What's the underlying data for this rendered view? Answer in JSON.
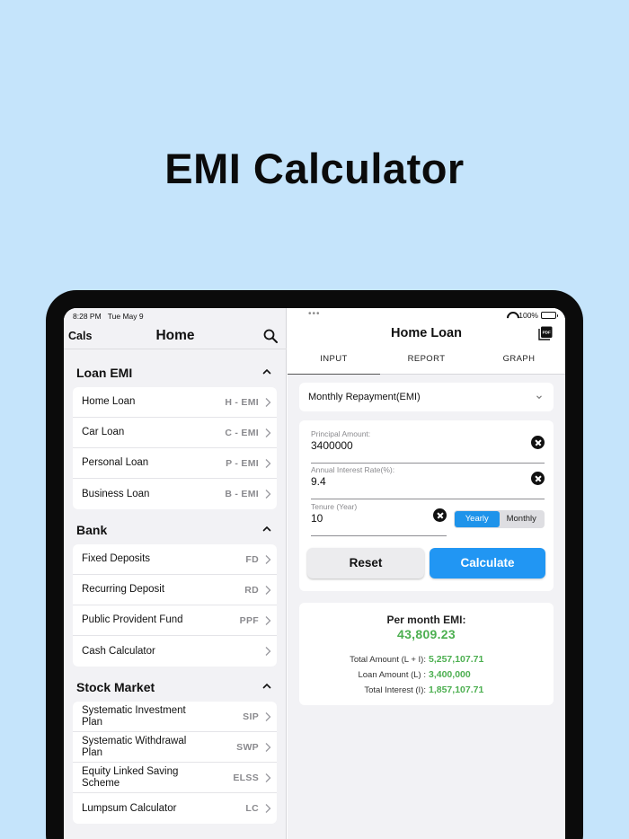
{
  "headline": "EMI Calculator",
  "status": {
    "time": "8:28 PM",
    "date": "Tue May 9",
    "dots": "•••",
    "battery": "100%"
  },
  "sidebar": {
    "left_label": "Cals",
    "title": "Home",
    "sections": [
      {
        "title": "Loan EMI",
        "items": [
          {
            "label": "Home Loan",
            "code": "H - EMI"
          },
          {
            "label": "Car Loan",
            "code": "C - EMI"
          },
          {
            "label": "Personal Loan",
            "code": "P - EMI"
          },
          {
            "label": "Business Loan",
            "code": "B - EMI"
          }
        ]
      },
      {
        "title": "Bank",
        "items": [
          {
            "label": "Fixed Deposits",
            "code": "FD"
          },
          {
            "label": "Recurring Deposit",
            "code": "RD"
          },
          {
            "label": "Public Provident Fund",
            "code": "PPF"
          },
          {
            "label": "Cash Calculator",
            "code": ""
          }
        ]
      },
      {
        "title": "Stock Market",
        "items": [
          {
            "label": "Systematic Investment Plan",
            "code": "SIP"
          },
          {
            "label": "Systematic Withdrawal Plan",
            "code": "SWP"
          },
          {
            "label": "Equity Linked Saving Scheme",
            "code": "ELSS"
          },
          {
            "label": "Lumpsum Calculator",
            "code": "LC"
          }
        ]
      }
    ]
  },
  "main": {
    "title": "Home Loan",
    "pdf_icon": "PDF",
    "tabs": [
      {
        "label": "INPUT"
      },
      {
        "label": "REPORT"
      },
      {
        "label": "GRAPH"
      }
    ],
    "active_tab": "INPUT",
    "repayment_mode": "Monthly Repayment(EMI)",
    "fields": {
      "principal": {
        "label": "Principal Amount:",
        "value": "3400000"
      },
      "rate": {
        "label": "Annual Interest Rate(%):",
        "value": "9.4"
      },
      "tenure": {
        "label": "Tenure (Year)",
        "value": "10"
      }
    },
    "tenure_units": {
      "yearly": "Yearly",
      "monthly": "Monthly",
      "selected": "Yearly"
    },
    "buttons": {
      "reset": "Reset",
      "calculate": "Calculate"
    },
    "result": {
      "heading": "Per month EMI:",
      "emi": "43,809.23",
      "total_amount_label": "Total Amount (L + I):",
      "total_amount": "5,257,107.71",
      "loan_amount_label": "Loan Amount (L) :",
      "loan_amount": "3,400,000",
      "total_interest_label": "Total Interest (I):",
      "total_interest": "1,857,107.71"
    }
  },
  "colors": {
    "accent": "#2196f3",
    "positive": "#4caf50",
    "background": "#c5e4fb"
  }
}
